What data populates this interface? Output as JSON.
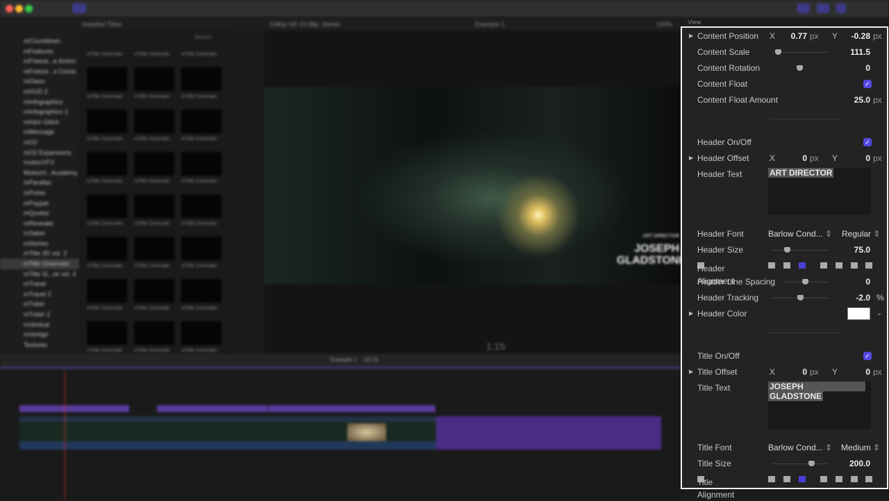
{
  "window": {
    "traffic_colors": [
      "#fc5f57",
      "#fdbc2e",
      "#34c84a"
    ]
  },
  "browser": {
    "title": "Installed Titles",
    "search_placeholder": "Search",
    "sidebar_items": [
      "mCountdown",
      "mFeatures",
      "mFreeze...e Action",
      "mFreeze...e Comic",
      "mGlass",
      "mHUD 2",
      "mInfographics",
      "mInfographics 2",
      "mIntro Glitch",
      "mMessage",
      "mO2",
      "mO2 Expansions",
      "motionVFX",
      "MotionV...Academy",
      "mParallax",
      "mPorter",
      "mPuppet",
      "mQuotes",
      "mRevealer",
      "mSaber",
      "mStories",
      "mTitle 3D vol. 3",
      "mTitle Cinematic",
      "mTitle Sl...ck vol. 4",
      "mTravel",
      "mTravel 2",
      "mTuber",
      "mTuber 2",
      "mVertical",
      "mVertigo",
      "Textures"
    ],
    "selected_item": "mTitle Cinematic",
    "thumb_label": "mTitle Cinematic"
  },
  "viewer": {
    "format": "1080p HD 23.98p, Stereo",
    "project": "Example 1",
    "zoom": "100%",
    "view": "View",
    "overlay_header": "ART DIRECTOR",
    "overlay_title": "JOSEPH GLADSTONE",
    "timecode": "1:15"
  },
  "timeline": {
    "project": "Example 1",
    "duration": "22:19"
  },
  "inspector": {
    "content_position": {
      "label": "Content Position",
      "x_label": "X",
      "x": "0.77",
      "y_label": "Y",
      "y": "-0.28",
      "unit": "px"
    },
    "content_scale": {
      "label": "Content Scale",
      "value": "111.5"
    },
    "content_rotation": {
      "label": "Content Rotation",
      "value": "0"
    },
    "content_float": {
      "label": "Content Float",
      "checked": true
    },
    "content_float_amount": {
      "label": "Content Float Amount",
      "value": "25.0",
      "unit": "px"
    },
    "header_onoff": {
      "label": "Header On/Off",
      "checked": true
    },
    "header_offset": {
      "label": "Header Offset",
      "x_label": "X",
      "x": "0",
      "y_label": "Y",
      "y": "0",
      "unit": "px"
    },
    "header_text": {
      "label": "Header Text",
      "value": "ART DIRECTOR"
    },
    "header_font": {
      "label": "Header Font",
      "family": "Barlow Cond...",
      "weight": "Regular"
    },
    "header_size": {
      "label": "Header Size",
      "value": "75.0"
    },
    "header_alignment": {
      "label": "Header Alignment",
      "selected": "right"
    },
    "header_line_spacing": {
      "label": "Header Line Spacing",
      "value": "0"
    },
    "header_tracking": {
      "label": "Header Tracking",
      "value": "-2.0",
      "unit": "%"
    },
    "header_color": {
      "label": "Header Color",
      "color": "#ffffff"
    },
    "title_onoff": {
      "label": "Title On/Off",
      "checked": true
    },
    "title_offset": {
      "label": "Title Offset",
      "x_label": "X",
      "x": "0",
      "y_label": "Y",
      "y": "0",
      "unit": "px"
    },
    "title_text": {
      "label": "Title Text",
      "line1": "JOSEPH",
      "line2": "GLADSTONE"
    },
    "title_font": {
      "label": "Title Font",
      "family": "Barlow Cond...",
      "weight": "Medium"
    },
    "title_size": {
      "label": "Title Size",
      "value": "200.0"
    },
    "title_alignment": {
      "label": "Title Alignment",
      "selected": "right"
    },
    "accent": "#5549e0"
  }
}
